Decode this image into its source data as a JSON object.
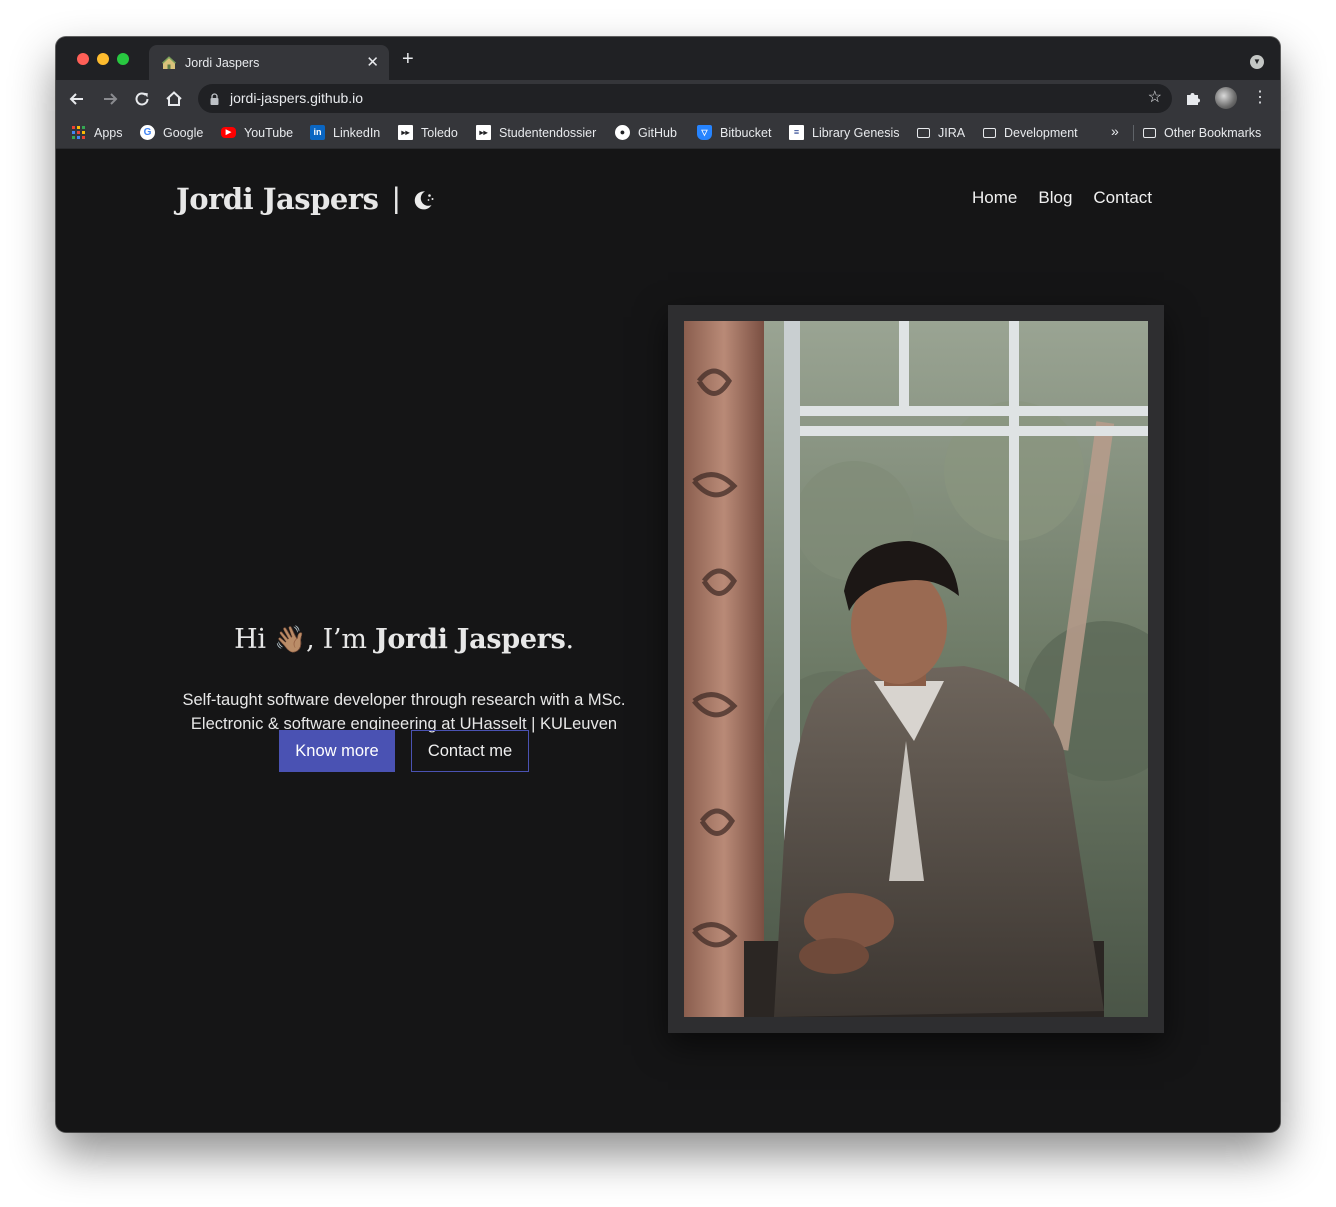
{
  "browser": {
    "tab": {
      "title": "Jordi Jaspers",
      "favicon": "house-icon",
      "close_glyph": "✕"
    },
    "new_tab_glyph": "+",
    "address_bar": {
      "url": "jordi-jaspers.github.io"
    },
    "bookmarks": [
      {
        "label": "Apps",
        "icon": "apps-grid-icon"
      },
      {
        "label": "Google",
        "icon": "google-icon"
      },
      {
        "label": "YouTube",
        "icon": "youtube-icon"
      },
      {
        "label": "LinkedIn",
        "icon": "linkedin-icon"
      },
      {
        "label": "Toledo",
        "icon": "toledo-icon"
      },
      {
        "label": "Studentendossier",
        "icon": "toledo-icon"
      },
      {
        "label": "GitHub",
        "icon": "github-icon"
      },
      {
        "label": "Bitbucket",
        "icon": "bitbucket-icon"
      },
      {
        "label": "Library Genesis",
        "icon": "library-icon"
      },
      {
        "label": "JIRA",
        "icon": "folder-icon"
      },
      {
        "label": "Development",
        "icon": "folder-icon"
      }
    ],
    "bookmarks_overflow": "»",
    "other_bookmarks": "Other Bookmarks"
  },
  "site": {
    "brand": {
      "name": "Jordi Jaspers",
      "divider": "|"
    },
    "nav": [
      "Home",
      "Blog",
      "Contact"
    ],
    "hero": {
      "greeting": "Hi",
      "wave": "👋🏽",
      "intro": ", I’m",
      "name": "Jordi Jaspers",
      "period": ".",
      "subtitle_line1": "Self-taught software developer through research with a MSc.",
      "subtitle_line2": "Electronic & software engineering at UHasselt | KULeuven",
      "primary_button": "Know more",
      "secondary_button": "Contact me"
    },
    "colors": {
      "accent": "#4a52b3",
      "background": "#151516",
      "text": "#e7e7e7"
    }
  }
}
